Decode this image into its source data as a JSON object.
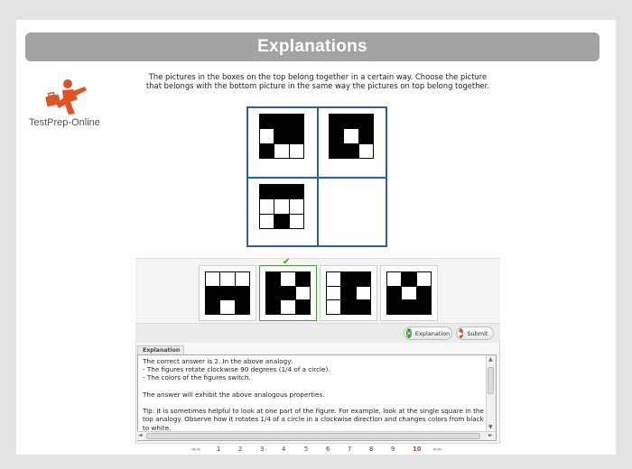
{
  "header": {
    "title": "Explanations"
  },
  "brand": {
    "name": "TestPrep-Online",
    "color": "#e2531f"
  },
  "question": {
    "text": "The pictures in the boxes on the top belong together in a certain way. Choose the picture that belongs with the bottom picture in the same way the pictures on top belong together."
  },
  "puzzle": {
    "top_left": [
      1,
      1,
      1,
      0,
      1,
      1,
      1,
      0,
      0
    ],
    "top_right": [
      1,
      1,
      1,
      1,
      0,
      1,
      1,
      1,
      0
    ],
    "bottom_left": [
      1,
      1,
      1,
      0,
      0,
      0,
      0,
      1,
      0
    ]
  },
  "answers": {
    "selected_index": 1,
    "options": [
      [
        0,
        0,
        0,
        1,
        1,
        1,
        1,
        0,
        1
      ],
      [
        1,
        0,
        1,
        1,
        1,
        0,
        1,
        0,
        1
      ],
      [
        0,
        1,
        1,
        0,
        1,
        0,
        0,
        1,
        1
      ],
      [
        0,
        1,
        0,
        1,
        0,
        1,
        1,
        1,
        1
      ]
    ]
  },
  "buttons": {
    "explanation_label": "Explanation",
    "submit_label": "Submit"
  },
  "explanation": {
    "tab_label": "Explanation",
    "text": "The correct answer is 2. In the above analogy:\n- The figures rotate clockwise 90 degrees (1/4 of a circle).\n- The colors of the figures switch.\n\nThe answer will exhibit the above analogous properties.\n\nTip: It is sometimes helpful to look at one part of the figure. For example, look at the single square in the top analogy. Observe how it rotates 1/4 of a circle in a clockwise direction and changes colors from black to white."
  },
  "pager": {
    "prev": "◄◄",
    "next": "►►",
    "pages": [
      "1",
      "2",
      "3",
      "4",
      "5",
      "6",
      "7",
      "8",
      "9",
      "10"
    ],
    "current": "10"
  },
  "colors": {
    "accent_blue": "#2d5ea8",
    "selected_green": "#4a9a3c",
    "banner_gray": "#a3a3a3"
  }
}
